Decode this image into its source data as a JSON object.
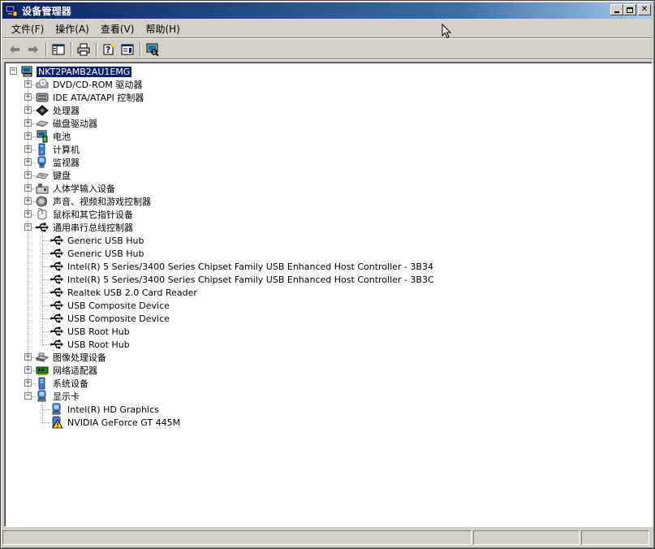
{
  "window": {
    "title": "设备管理器"
  },
  "menu": [
    {
      "label": "文件(F)"
    },
    {
      "label": "操作(A)"
    },
    {
      "label": "查看(V)"
    },
    {
      "label": "帮助(H)"
    }
  ],
  "tree": {
    "root": "NKT2PAMB2AU1EMG",
    "categories": [
      {
        "label": "DVD/CD-ROM 驱动器",
        "icon": "dvd-drive-icon",
        "expanded": false
      },
      {
        "label": "IDE ATA/ATAPI 控制器",
        "icon": "ide-controller-icon",
        "expanded": false
      },
      {
        "label": "处理器",
        "icon": "processor-icon",
        "expanded": false
      },
      {
        "label": "磁盘驱动器",
        "icon": "disk-drive-icon",
        "expanded": false
      },
      {
        "label": "电池",
        "icon": "battery-icon",
        "expanded": false
      },
      {
        "label": "计算机",
        "icon": "computer-icon",
        "expanded": false
      },
      {
        "label": "监视器",
        "icon": "monitor-icon",
        "expanded": false
      },
      {
        "label": "键盘",
        "icon": "keyboard-icon",
        "expanded": false
      },
      {
        "label": "人体学输入设备",
        "icon": "hid-icon",
        "expanded": false
      },
      {
        "label": "声音、视频和游戏控制器",
        "icon": "sound-icon",
        "expanded": false
      },
      {
        "label": "鼠标和其它指针设备",
        "icon": "mouse-icon",
        "expanded": false
      },
      {
        "label": "通用串行总线控制器",
        "icon": "usb-icon",
        "expanded": true,
        "children": [
          "Generic USB Hub",
          "Generic USB Hub",
          "Intel(R) 5 Series/3400 Series Chipset Family USB Enhanced Host Controller - 3B34",
          "Intel(R) 5 Series/3400 Series Chipset Family USB Enhanced Host Controller - 3B3C",
          "Realtek USB 2.0 Card Reader",
          "USB Composite Device",
          "USB Composite Device",
          "USB Root Hub",
          "USB Root Hub"
        ]
      },
      {
        "label": "图像处理设备",
        "icon": "imaging-icon",
        "expanded": false
      },
      {
        "label": "网络适配器",
        "icon": "network-adapter-icon",
        "expanded": false
      },
      {
        "label": "系统设备",
        "icon": "system-device-icon",
        "expanded": false
      },
      {
        "label": "显示卡",
        "icon": "display-adapter-icon",
        "expanded": true,
        "children": [
          {
            "label": "Intel(R) HD Graphics",
            "warning": false
          },
          {
            "label": "NVIDIA GeForce GT 445M",
            "warning": true
          }
        ]
      }
    ]
  },
  "colors": {
    "selection": "#0a246a",
    "titlebar": "#0a246a",
    "face": "#d4d0c8"
  }
}
